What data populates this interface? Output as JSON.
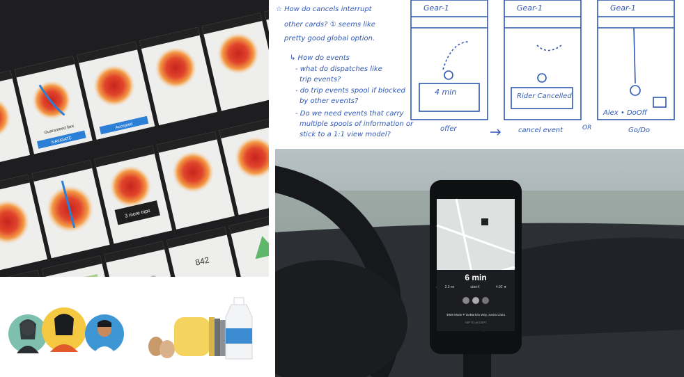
{
  "sketch": {
    "notes": [
      "☆ How do cancels interrupt",
      "other cards? ① seems like",
      "pretty good global option.",
      "↳ How do events",
      "- what do dispatches like",
      "trip events?",
      "- do trip events spool if blocked",
      "by other events?",
      "- Do we need events that carry",
      "multiple spools of information or",
      "stick to a 1:1 view model?"
    ],
    "frames": [
      {
        "header": "Gear-1",
        "card": "4 min",
        "caption": "offer"
      },
      {
        "header": "Gear-1",
        "card": "Rider Cancelled",
        "caption": "cancel event"
      },
      {
        "header": "Gear-1",
        "card": "Alex • DoOff",
        "caption": "Go/Do"
      }
    ],
    "or_label": "OR"
  },
  "phone": {
    "eta": "6 min",
    "stats": [
      "2.3 mi",
      "uberX",
      "4.92 ★"
    ],
    "address": "4908 Marie P DeBartolo Way, Santa Clara",
    "cta": "TAP TO ACCEPT"
  },
  "wall": {
    "card_labels": [
      "Guaranteed fare",
      "Accepted",
      "3 more trips",
      "842",
      "NAVIGATE"
    ]
  },
  "colors": {
    "sketch_ink": "#2f57b3",
    "heat_red": "#e0452b",
    "heat_orange": "#f39a45",
    "uber_blue": "#2c7fd6"
  }
}
